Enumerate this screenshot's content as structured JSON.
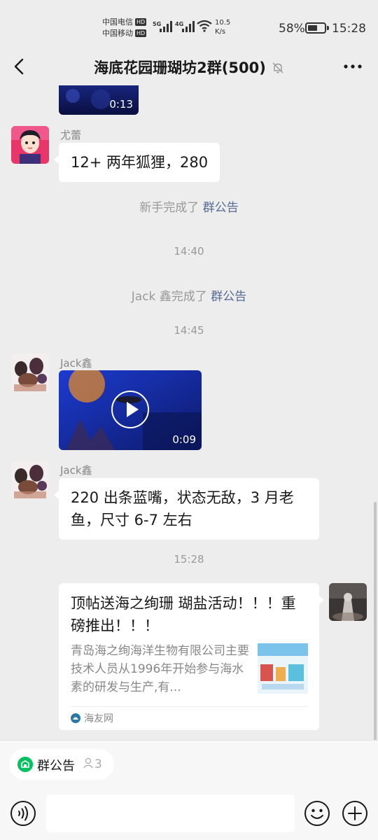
{
  "status_bar": {
    "carrier1": "中国电信",
    "carrier2": "中国移动",
    "hd": "HD",
    "net1": "5G",
    "net2": "4G",
    "speed_value": "10.5",
    "speed_unit": "K/s",
    "battery": "58%",
    "battery_level_percent": 58,
    "time": "15:28"
  },
  "header": {
    "title": "海底花园珊瑚坊2群(500)"
  },
  "messages": {
    "video1": {
      "duration": "0:13"
    },
    "msg1": {
      "sender": "尤蕾",
      "text": "12+ 两年狐狸，280"
    },
    "sys1": {
      "text": "新手完成了 ",
      "link": "群公告"
    },
    "time1": "14:40",
    "sys2": {
      "text": "Jack 鑫完成了 ",
      "link": "群公告"
    },
    "time2": "14:45",
    "video2": {
      "sender": "Jack鑫",
      "duration": "0:09"
    },
    "msg3": {
      "sender": "Jack鑫",
      "text": "220 出条蓝嘴，状态无敌，3 月老鱼，尺寸 6-7 左右"
    },
    "time3": "15:28",
    "card": {
      "title": "顶帖送海之绚珊 瑚盐活动！！！重磅推出！！！",
      "desc": "青岛海之绚海洋生物有限公司主要技术人员从1996年开始参与海水素的研发与生产,有...",
      "source": "海友网"
    }
  },
  "bottom": {
    "notice_label": "群公告",
    "member_count": "3",
    "input_placeholder": ""
  },
  "colors": {
    "background": "#ededed",
    "accent_green": "#07c160",
    "link_blue": "#576b95"
  },
  "icons": [
    "back-icon",
    "mute-icon",
    "more-icon",
    "play-icon",
    "voice-icon",
    "emoji-icon",
    "plus-icon",
    "group-notice-icon",
    "person-icon",
    "source-icon"
  ]
}
